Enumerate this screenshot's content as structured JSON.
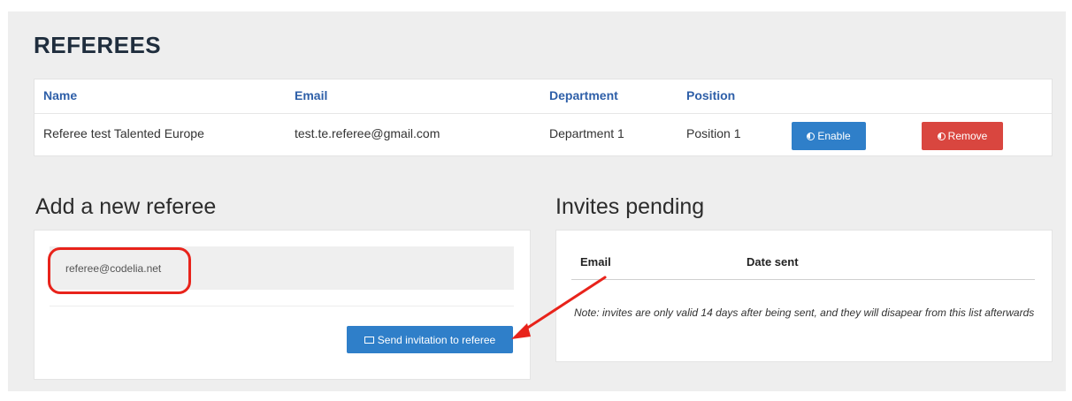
{
  "page": {
    "title": "REFEREES"
  },
  "referees_table": {
    "columns": [
      "Name",
      "Email",
      "Department",
      "Position"
    ],
    "rows": [
      {
        "name": "Referee test Talented Europe",
        "email": "test.te.referee@gmail.com",
        "department": "Department 1",
        "position": "Position 1",
        "enable_label": "Enable",
        "remove_label": "Remove"
      }
    ]
  },
  "add_referee": {
    "title": "Add a new referee",
    "email_value": "referee@codelia.net",
    "send_label": "Send invitation to referee"
  },
  "invites": {
    "title": "Invites pending",
    "columns": [
      "Email",
      "Date sent"
    ],
    "note": "Note: invites are only valid 14 days after being sent, and they will disapear from this list afterwards"
  },
  "colors": {
    "primary": "#2f7fc9",
    "danger": "#d9463f",
    "header_text": "#2e5fa8",
    "annotation": "#e8231b"
  }
}
